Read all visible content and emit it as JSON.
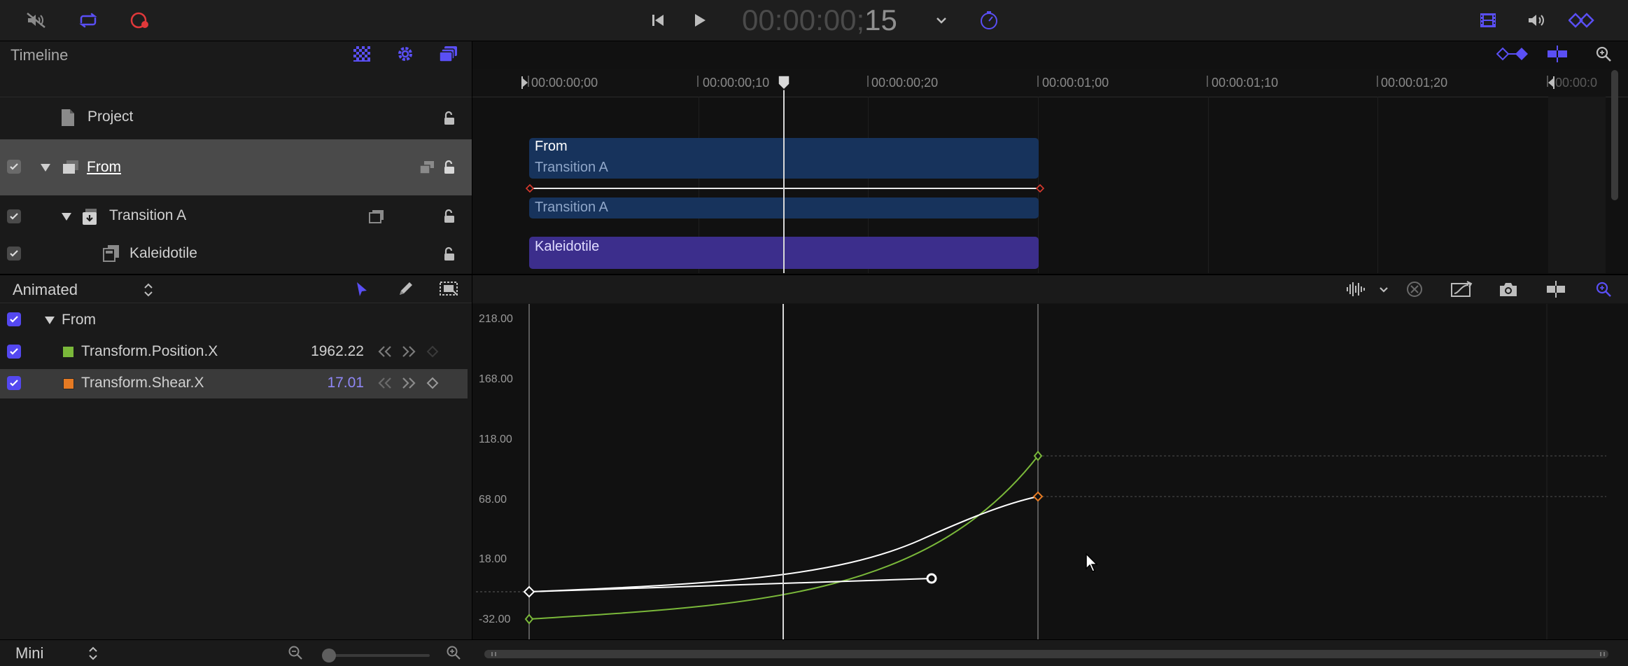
{
  "toolbar": {
    "timecode_dim": "00:00:00;",
    "timecode_frames": "15",
    "colors": {
      "accent": "#5a4ff5",
      "record": "#e0383a"
    }
  },
  "timeline": {
    "title": "Timeline",
    "ruler": [
      "00:00:00;00",
      "00:00:00;10",
      "00:00:00;20",
      "00:00:01;00",
      "00:00:01;10",
      "00:00:01;20",
      "00:00:0"
    ],
    "layers": [
      {
        "name": "Project"
      },
      {
        "name": "From"
      },
      {
        "name": "Transition A"
      },
      {
        "name": "Kaleidotile"
      }
    ],
    "clips": {
      "from_title": "From",
      "from_sub": "Transition A",
      "transition": "Transition A",
      "kaleido": "Kaleidotile"
    }
  },
  "keyframe_editor": {
    "filter": "Animated",
    "root": "From",
    "params": [
      {
        "name": "Transform.Position.X",
        "value": "1962.22",
        "color": "#7ab83a"
      },
      {
        "name": "Transform.Shear.X",
        "value": "17.01",
        "color": "#e57a23"
      }
    ],
    "y_ticks": [
      "218.00",
      "168.00",
      "118.00",
      "68.00",
      "18.00",
      "-32.00"
    ],
    "zoom_label": "Mini"
  }
}
